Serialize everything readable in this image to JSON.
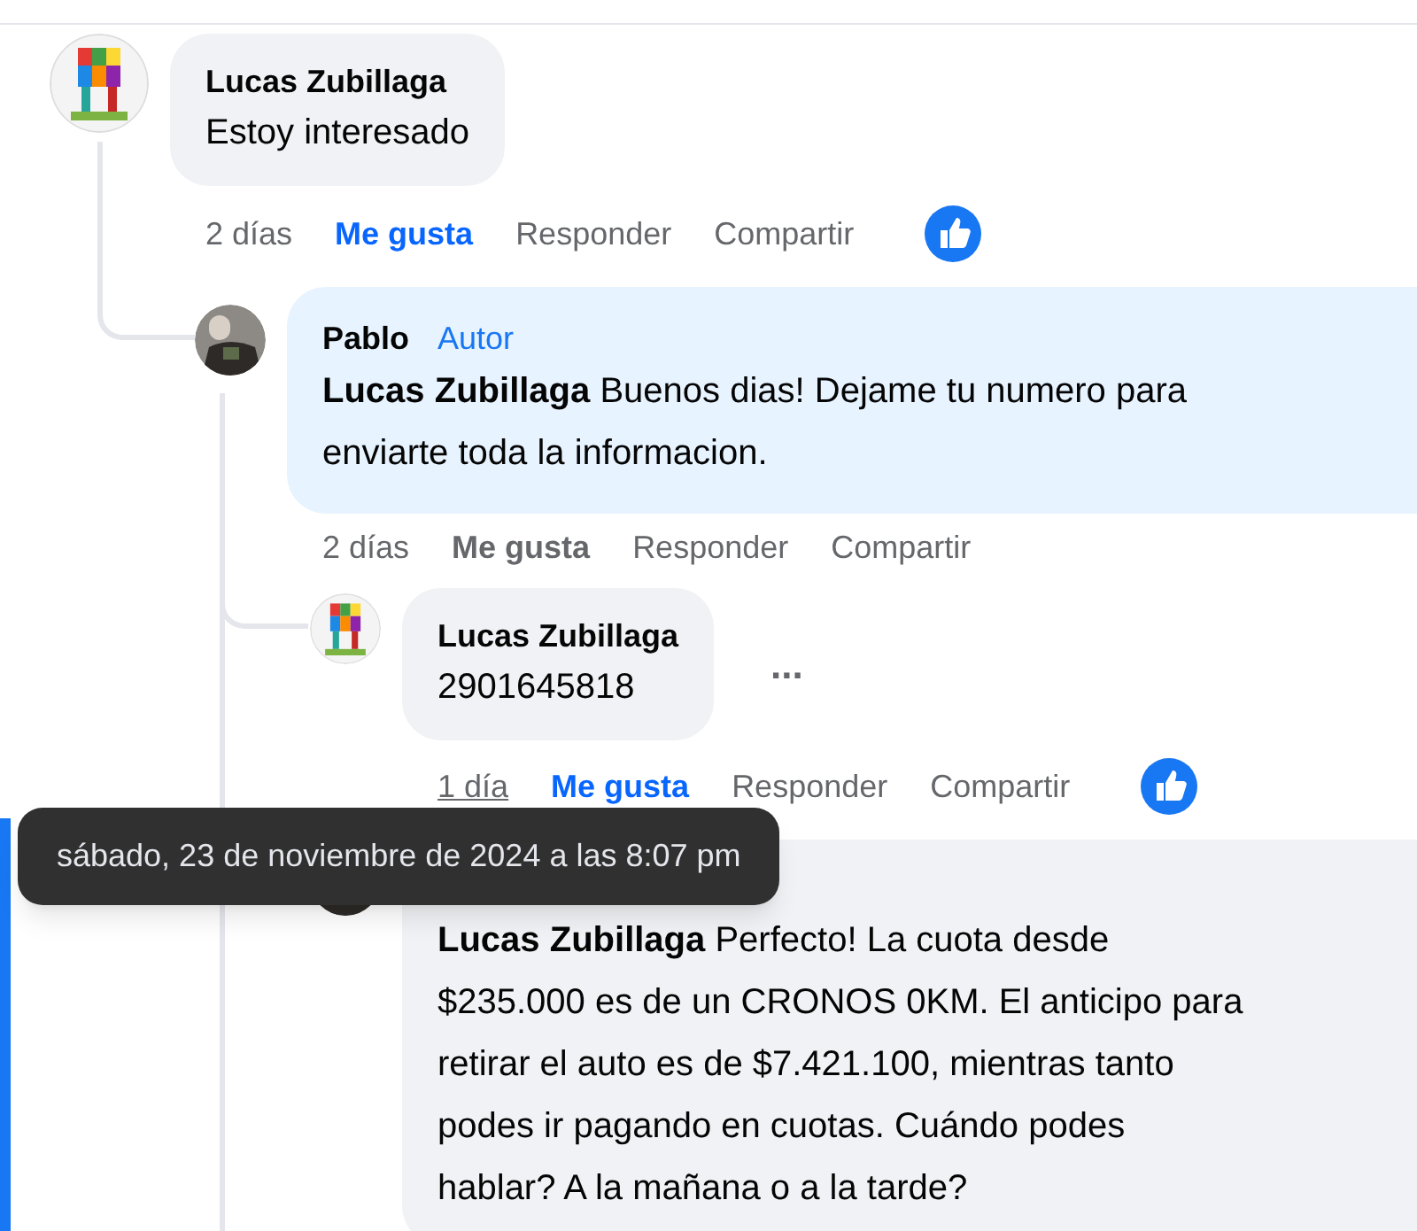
{
  "comments": [
    {
      "kind": "cube",
      "author": "Lucas Zubillaga",
      "text": "Estoy interesado",
      "time": "2 días",
      "time_hovered": false,
      "like": {
        "label": "Me gusta",
        "selected": true
      },
      "reply": "Responder",
      "share": "Compartir",
      "reaction": true,
      "children": [
        {
          "kind": "person",
          "author": "Pablo",
          "badge": "Autor",
          "mention": "Lucas Zubillaga",
          "text": "Buenos dias! Dejame tu numero para enviarte toda la informacion.",
          "time": "2 días",
          "time_hovered": false,
          "like": {
            "label": "Me gusta",
            "selected": false
          },
          "reply": "Responder",
          "share": "Compartir",
          "children": [
            {
              "kind": "cube",
              "author": "Lucas Zubillaga",
              "text": "2901645818",
              "more_menu": true,
              "more_label": "...",
              "time": "1 día",
              "time_hovered": true,
              "like": {
                "label": "Me gusta",
                "selected": true
              },
              "reply": "Responder",
              "share": "Compartir",
              "reaction": true
            },
            {
              "kind": "person",
              "mention": "Lucas Zubillaga",
              "text": "Perfecto! La cuota desde $235.000 es de un CRONOS 0KM. El anticipo para retirar el auto es de $7.421.100, mientras tanto podes ir pagando en cuotas. Cuándo podes hablar? A la mañana o a la tarde?",
              "highlighted": true
            }
          ]
        }
      ]
    }
  ],
  "tooltip": {
    "text": "sábado, 23 de noviembre de 2024 a las 8:07 pm"
  }
}
